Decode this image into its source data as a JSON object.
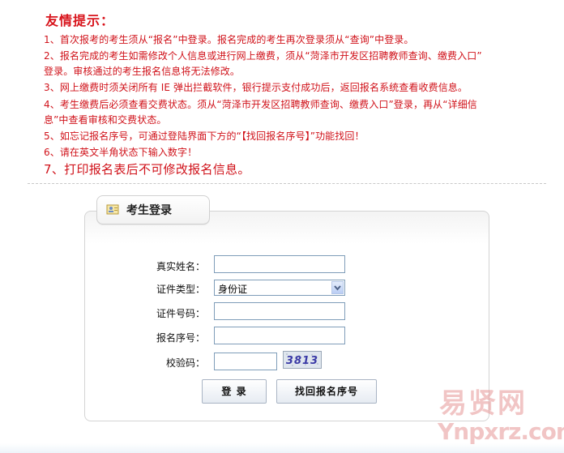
{
  "notice": {
    "title": "友情提示：",
    "lines": [
      "1、首次报考的考生须从“报名”中登录。报名完成的考生再次登录须从“查询”中登录。",
      "2、报名完成的考生如需修改个人信息或进行网上缴费，须从“菏泽市开发区招聘教师查询、缴费入口”",
      "登录。审核通过的考生报名信息将无法修改。",
      "3、网上缴费时须关闭所有 IE 弹出拦截软件，银行提示支付成功后，返回报名系统查看收费信息。",
      "4、考生缴费后必须查看交费状态。须从“菏泽市开发区招聘教师查询、缴费入口”登录，再从“详细信",
      "息”中查看审核和交费状态。",
      "5、如忘记报名序号，可通过登陆界面下方的“【找回报名序号】”功能找回！",
      "6、请在英文半角状态下输入数字！",
      "7、打印报名表后不可修改报名信息。"
    ]
  },
  "login": {
    "tab_title": "考生登录",
    "name_label": "真实姓名：",
    "name_value": "",
    "id_type_label": "证件类型：",
    "id_type_selected": "身份证",
    "id_number_label": "证件号码：",
    "id_number_value": "",
    "serial_label": "报名序号：",
    "serial_value": "",
    "captcha_label": "校验码：",
    "captcha_value": "",
    "captcha_text": "3813",
    "login_button": "登 录",
    "recover_button": "找回报名序号"
  },
  "watermark": {
    "text_cn": "易贤网",
    "text_en": "Ynpxrz.com"
  },
  "colors": {
    "notice_red": "#d0121a",
    "input_border": "#7f9db9",
    "panel_border": "#d4d4d4"
  }
}
